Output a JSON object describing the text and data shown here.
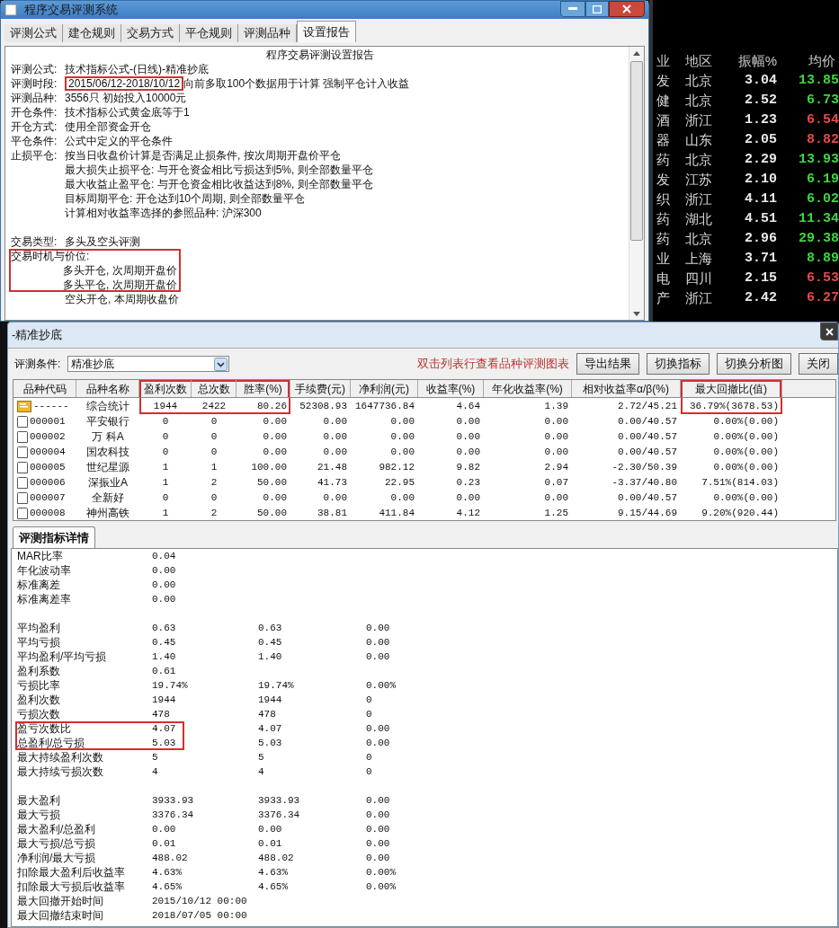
{
  "main_window": {
    "title": "程序交易评测系统",
    "tabs": [
      {
        "label": "评测公式",
        "selected": false
      },
      {
        "label": "建仓规则",
        "selected": false
      },
      {
        "label": "交易方式",
        "selected": false
      },
      {
        "label": "平仓规则",
        "selected": false
      },
      {
        "label": "评测品种",
        "selected": false
      },
      {
        "label": "设置报告",
        "selected": true
      }
    ],
    "report": {
      "title": "程序交易评测设置报告",
      "blocks": [
        {
          "lines": [
            {
              "label": "评测公式:",
              "value": "技术指标公式-(日线)-精准抄底",
              "highlighted": false
            },
            {
              "label": "评测时段:",
              "value": "2015/06/12-2018/10/12",
              "note": "向前多取100个数据用于计算 强制平仓计入收益",
              "highlighted": true
            },
            {
              "label": "评测品种:",
              "value": "3556只 初始投入10000元",
              "highlighted": false
            },
            {
              "label": "开仓条件:",
              "value": "技术指标公式黄金底等于1",
              "highlighted": false
            },
            {
              "label": "开仓方式:",
              "value": "使用全部资金开仓",
              "highlighted": false
            },
            {
              "label": "平仓条件:",
              "value": "公式中定义的平仓条件",
              "highlighted": false
            },
            {
              "label": "止损平仓:",
              "value": "按当日收盘价计算是否满足止损条件, 按次周期开盘价平仓",
              "highlighted": false
            },
            {
              "value": "最大损失止损平仓: 与开仓资金相比亏损达到5%, 则全部数量平仓",
              "highlighted": false
            },
            {
              "value": "最大收益止盈平仓: 与开仓资金相比收益达到8%, 则全部数量平仓",
              "highlighted": false
            },
            {
              "value": "目标周期平仓: 开仓达到10个周期, 则全部数量平仓",
              "highlighted": false
            },
            {
              "value": "计算相对收益率选择的参照品种: 沪深300",
              "highlighted": false
            }
          ]
        },
        {
          "lines": [
            {
              "label": "交易类型:",
              "value": "多头及空头评测",
              "highlighted": false
            },
            {
              "label": "交易时机与价位:",
              "highlighted": true
            },
            {
              "value": "多头开仓, 次周期开盘价",
              "highlighted": true
            },
            {
              "value": "多头平仓, 次周期开盘价",
              "highlighted": true
            },
            {
              "value": "空头开仓, 本周期收盘价",
              "highlighted": false
            }
          ]
        }
      ]
    }
  },
  "quote_list": {
    "columns": [
      "业",
      "地区",
      "振幅%",
      "均价"
    ],
    "rows": [
      {
        "cells": [
          "发",
          "北京",
          "3.04",
          "13.85"
        ],
        "color": "#3ad83a"
      },
      {
        "cells": [
          "健",
          "北京",
          "2.52",
          "6.73"
        ],
        "color": "#3ad83a"
      },
      {
        "cells": [
          "酒",
          "浙江",
          "1.23",
          "6.54"
        ],
        "color": "#e84848"
      },
      {
        "cells": [
          "器",
          "山东",
          "2.05",
          "8.82"
        ],
        "color": "#e84848"
      },
      {
        "cells": [
          "药",
          "北京",
          "2.29",
          "13.93"
        ],
        "color": "#3ad83a"
      },
      {
        "cells": [
          "发",
          "江苏",
          "2.10",
          "6.19"
        ],
        "color": "#3ad83a"
      },
      {
        "cells": [
          "织",
          "浙江",
          "4.11",
          "6.02"
        ],
        "color": "#3ad83a"
      },
      {
        "cells": [
          "药",
          "湖北",
          "4.51",
          "11.34"
        ],
        "color": "#3ad83a"
      },
      {
        "cells": [
          "药",
          "北京",
          "2.96",
          "29.38"
        ],
        "color": "#3ad83a"
      },
      {
        "cells": [
          "业",
          "上海",
          "3.71",
          "8.89"
        ],
        "color": "#3ad83a"
      },
      {
        "cells": [
          "电",
          "四川",
          "2.15",
          "6.53"
        ],
        "color": "#e84848"
      },
      {
        "cells": [
          "产",
          "浙江",
          "2.42",
          "6.27"
        ],
        "color": "#e84848"
      }
    ]
  },
  "result_window": {
    "title": "-精准抄底",
    "condition_label": "评测条件:",
    "condition_value": "精准抄底",
    "hint": "双击列表行查看品种评测图表",
    "buttons": [
      "导出结果",
      "切换指标",
      "切换分析图",
      "关闭"
    ],
    "table": {
      "columns": [
        {
          "label": "品种代码",
          "highlighted": false
        },
        {
          "label": "品种名称",
          "highlighted": false
        },
        {
          "label": "盈利次数",
          "highlighted": true
        },
        {
          "label": "总次数",
          "highlighted": true
        },
        {
          "label": "胜率(%)",
          "highlighted": true
        },
        {
          "label": "手续费(元)",
          "highlighted": false
        },
        {
          "label": "净利润(元)",
          "highlighted": false
        },
        {
          "label": "收益率(%)",
          "highlighted": false
        },
        {
          "label": "年化收益率(%)",
          "highlighted": false
        },
        {
          "label": "相对收益率α/β(%)",
          "highlighted": false
        },
        {
          "label": "最大回撤比(值)",
          "highlighted": true
        }
      ],
      "rows": [
        {
          "kind": "summary",
          "highlighted": true,
          "cells": [
            "------",
            "综合统计",
            "1944",
            "2422",
            "80.26",
            "52308.93",
            "1647736.84",
            "4.64",
            "1.39",
            "2.72/45.21",
            "36.79%(3678.53)"
          ]
        },
        {
          "kind": "stock",
          "highlighted": false,
          "cells": [
            "000001",
            "平安银行",
            "0",
            "0",
            "0.00",
            "0.00",
            "0.00",
            "0.00",
            "0.00",
            "0.00/40.57",
            "0.00%(0.00)"
          ]
        },
        {
          "kind": "stock",
          "highlighted": false,
          "cells": [
            "000002",
            "万 科A",
            "0",
            "0",
            "0.00",
            "0.00",
            "0.00",
            "0.00",
            "0.00",
            "0.00/40.57",
            "0.00%(0.00)"
          ]
        },
        {
          "kind": "stock",
          "highlighted": false,
          "cells": [
            "000004",
            "国农科技",
            "0",
            "0",
            "0.00",
            "0.00",
            "0.00",
            "0.00",
            "0.00",
            "0.00/40.57",
            "0.00%(0.00)"
          ]
        },
        {
          "kind": "stock",
          "highlighted": false,
          "cells": [
            "000005",
            "世纪星源",
            "1",
            "1",
            "100.00",
            "21.48",
            "982.12",
            "9.82",
            "2.94",
            "-2.30/50.39",
            "0.00%(0.00)"
          ]
        },
        {
          "kind": "stock",
          "highlighted": false,
          "cells": [
            "000006",
            "深振业A",
            "1",
            "2",
            "50.00",
            "41.73",
            "22.95",
            "0.23",
            "0.07",
            "-3.37/40.80",
            "7.51%(814.03)"
          ]
        },
        {
          "kind": "stock",
          "highlighted": false,
          "cells": [
            "000007",
            "全新好",
            "0",
            "0",
            "0.00",
            "0.00",
            "0.00",
            "0.00",
            "0.00",
            "0.00/40.57",
            "0.00%(0.00)"
          ]
        },
        {
          "kind": "stock",
          "highlighted": false,
          "cells": [
            "000008",
            "神州高铁",
            "1",
            "2",
            "50.00",
            "38.81",
            "411.84",
            "4.12",
            "1.25",
            "9.15/44.69",
            "9.20%(920.44)"
          ]
        }
      ]
    },
    "detail_tabs": [
      {
        "label": "评测指标详情",
        "selected": true
      }
    ],
    "detail": {
      "groups": [
        {
          "rows": [
            {
              "label": "MAR比率",
              "values": [
                "0.04"
              ],
              "highlighted": false
            },
            {
              "label": "年化波动率",
              "values": [
                "0.00"
              ],
              "highlighted": false
            },
            {
              "label": "标准离差",
              "values": [
                "0.00"
              ],
              "highlighted": false
            },
            {
              "label": "标准离差率",
              "values": [
                "0.00"
              ],
              "highlighted": false
            }
          ]
        },
        {
          "rows": [
            {
              "label": "平均盈利",
              "values": [
                "0.63",
                "0.63",
                "0.00"
              ],
              "highlighted": false
            },
            {
              "label": "平均亏损",
              "values": [
                "0.45",
                "0.45",
                "0.00"
              ],
              "highlighted": false
            },
            {
              "label": "平均盈利/平均亏损",
              "values": [
                "1.40",
                "1.40",
                "0.00"
              ],
              "highlighted": false
            },
            {
              "label": "盈利系数",
              "values": [
                "0.61"
              ],
              "highlighted": false
            },
            {
              "label": "亏损比率",
              "values": [
                "19.74%",
                "19.74%",
                "0.00%"
              ],
              "highlighted": false
            },
            {
              "label": "盈利次数",
              "values": [
                "1944",
                "1944",
                "0"
              ],
              "highlighted": false
            },
            {
              "label": "亏损次数",
              "values": [
                "478",
                "478",
                "0"
              ],
              "highlighted": false
            },
            {
              "label": "盈亏次数比",
              "values": [
                "4.07",
                "4.07",
                "0.00"
              ],
              "highlighted": true
            },
            {
              "label": "总盈利/总亏损",
              "values": [
                "5.03",
                "5.03",
                "0.00"
              ],
              "highlighted": true
            },
            {
              "label": "最大持续盈利次数",
              "values": [
                "5",
                "5",
                "0"
              ],
              "highlighted": false
            },
            {
              "label": "最大持续亏损次数",
              "values": [
                "4",
                "4",
                "0"
              ],
              "highlighted": false
            }
          ]
        },
        {
          "rows": [
            {
              "label": "最大盈利",
              "values": [
                "3933.93",
                "3933.93",
                "0.00"
              ],
              "highlighted": false
            },
            {
              "label": "最大亏损",
              "values": [
                "3376.34",
                "3376.34",
                "0.00"
              ],
              "highlighted": false
            },
            {
              "label": "最大盈利/总盈利",
              "values": [
                "0.00",
                "0.00",
                "0.00"
              ],
              "highlighted": false
            },
            {
              "label": "最大亏损/总亏损",
              "values": [
                "0.01",
                "0.01",
                "0.00"
              ],
              "highlighted": false
            },
            {
              "label": "净利润/最大亏损",
              "values": [
                "488.02",
                "488.02",
                "0.00"
              ],
              "highlighted": false
            },
            {
              "label": "扣除最大盈利后收益率",
              "values": [
                "4.63%",
                "4.63%",
                "0.00%"
              ],
              "highlighted": false
            },
            {
              "label": "扣除最大亏损后收益率",
              "values": [
                "4.65%",
                "4.65%",
                "0.00%"
              ],
              "highlighted": false
            },
            {
              "label": "最大回撤开始时间",
              "values": [
                "2015/10/12 00:00"
              ],
              "highlighted": false
            },
            {
              "label": "最大回撤结束时间",
              "values": [
                "2018/07/05 00:00"
              ],
              "highlighted": false
            }
          ]
        }
      ]
    }
  }
}
